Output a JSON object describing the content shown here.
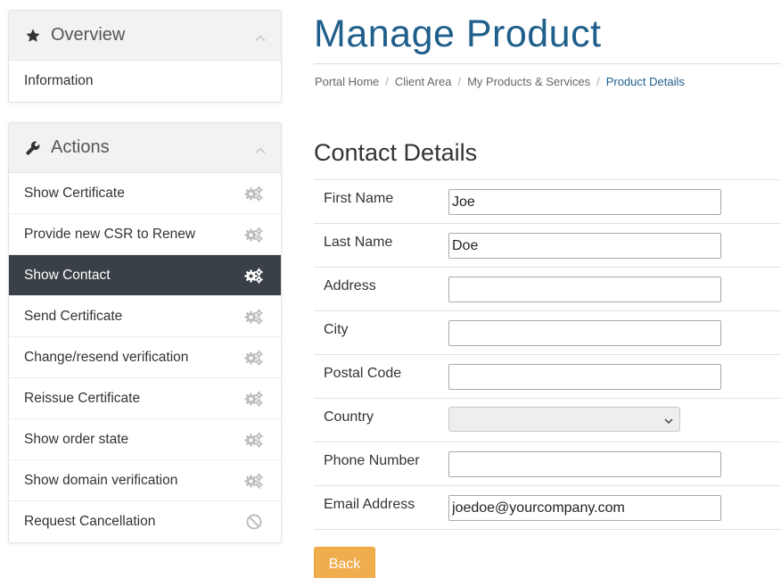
{
  "sidebar": {
    "overview": {
      "title": "Overview",
      "icon": "star-icon",
      "items": [
        {
          "label": "Information"
        }
      ]
    },
    "actions": {
      "title": "Actions",
      "icon": "wrench-icon",
      "items": [
        {
          "label": "Show Certificate",
          "icon": "gears-icon",
          "active": false
        },
        {
          "label": "Provide new CSR to Renew",
          "icon": "gears-icon",
          "active": false
        },
        {
          "label": "Show Contact",
          "icon": "gears-icon",
          "active": true
        },
        {
          "label": "Send Certificate",
          "icon": "gears-icon",
          "active": false
        },
        {
          "label": "Change/resend verification",
          "icon": "gears-icon",
          "active": false
        },
        {
          "label": "Reissue Certificate",
          "icon": "gears-icon",
          "active": false
        },
        {
          "label": "Show order state",
          "icon": "gears-icon",
          "active": false
        },
        {
          "label": "Show domain verification",
          "icon": "gears-icon",
          "active": false
        },
        {
          "label": "Request Cancellation",
          "icon": "ban-icon",
          "active": false
        }
      ]
    }
  },
  "header": {
    "title": "Manage Product",
    "breadcrumb": {
      "items": [
        "Portal Home",
        "Client Area",
        "My Products & Services"
      ],
      "current": "Product Details"
    }
  },
  "contact": {
    "title": "Contact Details",
    "fields": {
      "first_name": {
        "label": "First Name",
        "value": "Joe"
      },
      "last_name": {
        "label": "Last Name",
        "value": "Doe"
      },
      "address": {
        "label": "Address",
        "value": ""
      },
      "city": {
        "label": "City",
        "value": ""
      },
      "postal_code": {
        "label": "Postal Code",
        "value": ""
      },
      "country": {
        "label": "Country",
        "value": ""
      },
      "phone": {
        "label": "Phone Number",
        "value": ""
      },
      "email": {
        "label": "Email Address",
        "value": "joedoe@yourcompany.com"
      }
    },
    "back_label": "Back"
  },
  "colors": {
    "brand_blue": "#1f5f8b",
    "active_row": "#3a4047",
    "back_button": "#f0ad4e"
  }
}
